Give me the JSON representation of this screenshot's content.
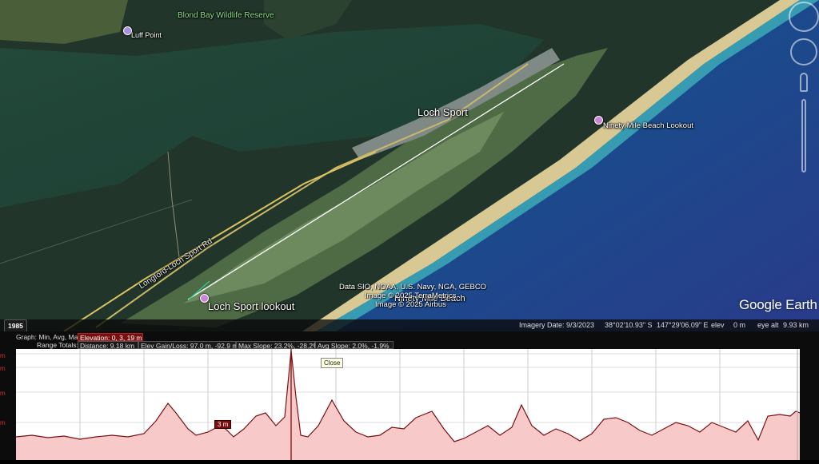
{
  "map": {
    "labels": {
      "reserve": "Blond Bay Wildlife Reserve",
      "luff_point": "Luff Point",
      "loch_sport": "Loch Sport",
      "ninety_mile_lookout": "Ninety Mile Beach Lookout",
      "road": "Longford-Loch Sport Rd",
      "loch_sport_lookout": "Loch Sport lookout",
      "ninety_mile_beach": "Ninety Mile Beach"
    },
    "credits": [
      "Data SIO, NOAA, U.S. Navy, NGA, GEBCO",
      "Image © 2025 TerraMetrics",
      "Image © 2025 Airbus"
    ],
    "logo": "Google Earth",
    "year": "1985"
  },
  "status": {
    "imagery_date": "Imagery Date: 9/3/2023",
    "lat": "38°02'10.93\" S",
    "lon": "147°29'06.09\" E",
    "elev_label": "elev",
    "elev_value": "0 m",
    "eye_alt_label": "eye alt",
    "eye_alt_value": "9.93 km"
  },
  "profile": {
    "row1": {
      "key": "Graph: Min, Avg, Max",
      "elevation": "Elevation: 0, 3, 19 m"
    },
    "row2": {
      "key": "Range Totals:",
      "distance": "Distance: 9.18 km",
      "gain_loss": "Elev Gain/Loss: 97.0 m, -92.9 m",
      "max_slope": "Max Slope: 23.2%, -28.2%",
      "avg_slope": "Avg Slope: 2.0%, -1.9%"
    },
    "y_ticks": [
      "m",
      "m",
      "m",
      "m"
    ],
    "close_label": "Close",
    "marker_label": "3 m",
    "colors": {
      "fill": "#f7c9c9",
      "line": "#7a1010",
      "marker": "#7a0e0e"
    }
  }
}
